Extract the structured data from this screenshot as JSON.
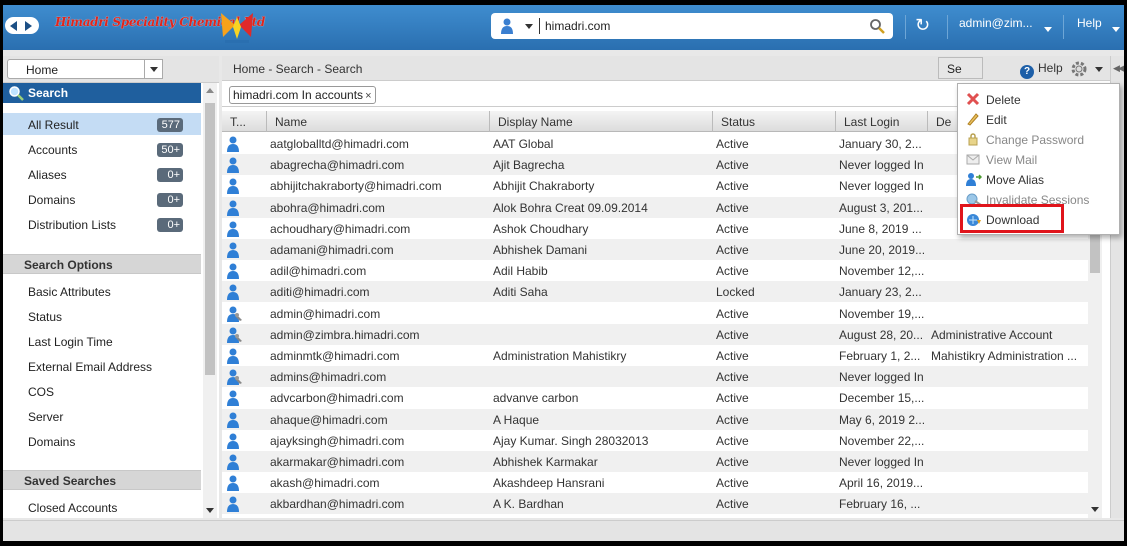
{
  "topbar": {
    "brand_text": "Himadri Speciality Chemical Ltd",
    "search_value": "himadri.com",
    "user_label": "admin@zim...",
    "help_label": "Help"
  },
  "left_panel": {
    "home_select": "Home",
    "search_header": "Search",
    "results": [
      {
        "label": "All Result",
        "count": "577",
        "selected": true
      },
      {
        "label": "Accounts",
        "count": "50+"
      },
      {
        "label": "Aliases",
        "count": "0+"
      },
      {
        "label": "Domains",
        "count": "0+"
      },
      {
        "label": "Distribution Lists",
        "count": "0+"
      }
    ],
    "search_options_header": "Search Options",
    "search_options": [
      "Basic Attributes",
      "Status",
      "Last Login Time",
      "External Email Address",
      "COS",
      "Server",
      "Domains"
    ],
    "saved_searches_header": "Saved Searches",
    "saved_searches": [
      "Closed Accounts"
    ]
  },
  "main": {
    "breadcrumb": "Home - Search - Search",
    "help_label": "Help",
    "query_chip": "himadri.com In accounts",
    "query_chip_close": "×",
    "search_button": "Se",
    "columns": [
      "T...",
      "Name",
      "Display Name",
      "Status",
      "Last Login",
      "De"
    ],
    "rows": [
      {
        "type": "user",
        "name": "aatgloballtd@himadri.com",
        "display": "AAT Global",
        "status": "Active",
        "login": "January 30, 2...",
        "desc": ""
      },
      {
        "type": "user",
        "name": "abagrecha@himadri.com",
        "display": "Ajit Bagrecha",
        "status": "Active",
        "login": "Never logged In",
        "desc": ""
      },
      {
        "type": "user",
        "name": "abhijitchakraborty@himadri.com",
        "display": "Abhijit Chakraborty",
        "status": "Active",
        "login": "Never logged In",
        "desc": ""
      },
      {
        "type": "user",
        "name": "abohra@himadri.com",
        "display": "Alok Bohra Creat 09.09.2014",
        "status": "Active",
        "login": "August 3, 201...",
        "desc": ""
      },
      {
        "type": "user",
        "name": "achoudhary@himadri.com",
        "display": "Ashok Choudhary",
        "status": "Active",
        "login": "June 8, 2019 ...",
        "desc": ""
      },
      {
        "type": "user",
        "name": "adamani@himadri.com",
        "display": "Abhishek Damani",
        "status": "Active",
        "login": "June 20, 2019...",
        "desc": ""
      },
      {
        "type": "user",
        "name": "adil@himadri.com",
        "display": "Adil Habib",
        "status": "Active",
        "login": "November 12,...",
        "desc": ""
      },
      {
        "type": "user",
        "name": "aditi@himadri.com",
        "display": "Aditi Saha",
        "status": "Locked",
        "login": "January 23, 2...",
        "desc": ""
      },
      {
        "type": "admin",
        "name": "admin@himadri.com",
        "display": "",
        "status": "Active",
        "login": "November 19,...",
        "desc": ""
      },
      {
        "type": "admin",
        "name": "admin@zimbra.himadri.com",
        "display": "",
        "status": "Active",
        "login": "August 28, 20...",
        "desc": "Administrative Account"
      },
      {
        "type": "user",
        "name": "adminmtk@himadri.com",
        "display": "Administration Mahistikry",
        "status": "Active",
        "login": "February 1, 2...",
        "desc": "Mahistikry Administration ..."
      },
      {
        "type": "admin",
        "name": "admins@himadri.com",
        "display": "",
        "status": "Active",
        "login": "Never logged In",
        "desc": ""
      },
      {
        "type": "user",
        "name": "advcarbon@himadri.com",
        "display": "advanve carbon",
        "status": "Active",
        "login": "December 15,...",
        "desc": ""
      },
      {
        "type": "user",
        "name": "ahaque@himadri.com",
        "display": "A Haque",
        "status": "Active",
        "login": "May 6, 2019 2...",
        "desc": ""
      },
      {
        "type": "user",
        "name": "ajayksingh@himadri.com",
        "display": "Ajay Kumar. Singh 28032013",
        "status": "Active",
        "login": "November 22,...",
        "desc": ""
      },
      {
        "type": "user",
        "name": "akarmakar@himadri.com",
        "display": "Abhishek Karmakar",
        "status": "Active",
        "login": "Never logged In",
        "desc": ""
      },
      {
        "type": "user",
        "name": "akash@himadri.com",
        "display": "Akashdeep Hansrani",
        "status": "Active",
        "login": "April 16, 2019...",
        "desc": ""
      },
      {
        "type": "user",
        "name": "akbardhan@himadri.com",
        "display": "A K. Bardhan",
        "status": "Active",
        "login": "February 16, ...",
        "desc": ""
      }
    ]
  },
  "action_menu": {
    "items": [
      {
        "label": "Delete",
        "icon": "delete-x-icon",
        "enabled": true
      },
      {
        "label": "Edit",
        "icon": "pencil-icon",
        "enabled": true
      },
      {
        "label": "Change Password",
        "icon": "lock-icon",
        "enabled": false
      },
      {
        "label": "View Mail",
        "icon": "mail-icon",
        "enabled": false
      },
      {
        "label": "Move Alias",
        "icon": "move-alias-icon",
        "enabled": true
      },
      {
        "label": "Invalidate Sessions",
        "icon": "invalidate-sessions-icon",
        "enabled": false
      },
      {
        "label": "Download",
        "icon": "download-icon",
        "enabled": true
      }
    ]
  },
  "colors": {
    "topbar": "#2f7bbf",
    "selected_row": "#c4dcf4",
    "search_header": "#1f5f9e",
    "highlight": "#e0141b"
  }
}
